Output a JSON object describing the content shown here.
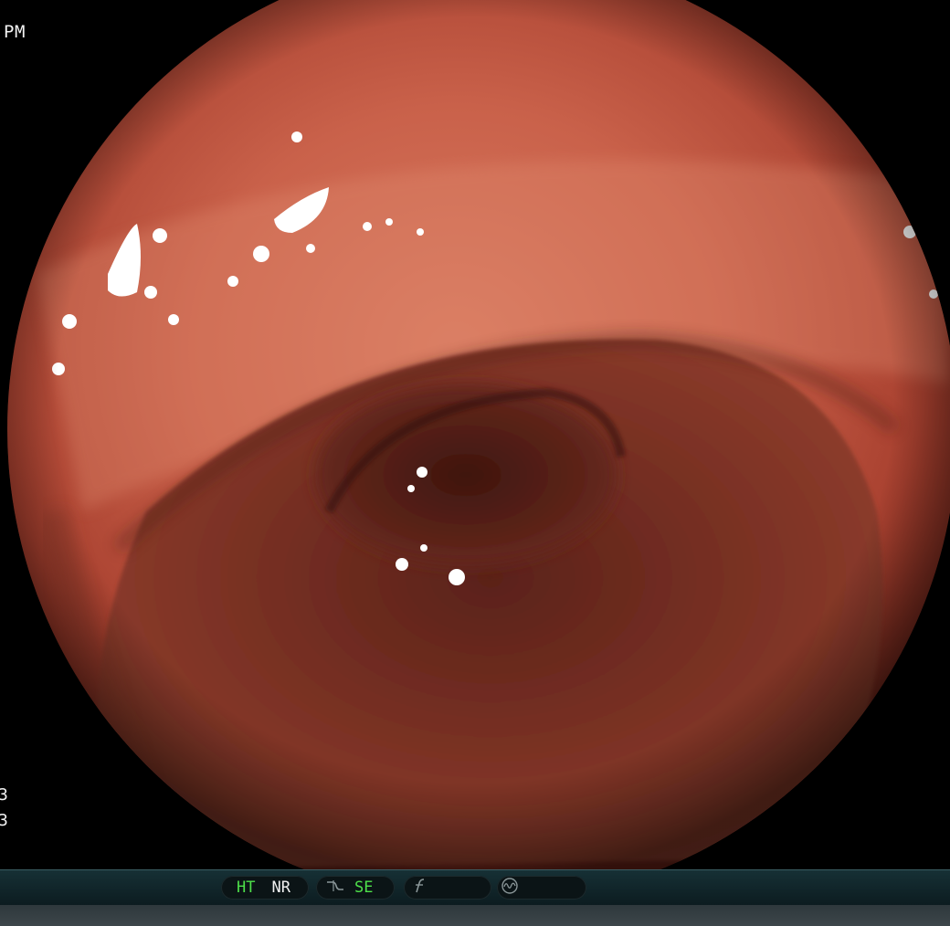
{
  "overlay": {
    "time_suffix": "PM",
    "left_char_1": "3",
    "left_char_2": "3"
  },
  "status_bar": {
    "ht": "HT",
    "nr": "NR",
    "se": "SE",
    "icons": [
      "contrast-curve-icon",
      "f-icon",
      "wave-circle-icon"
    ]
  },
  "colors": {
    "mucosa": "#c0533e",
    "lumen": "#6a2b1f",
    "status_green": "#4ee04a"
  }
}
